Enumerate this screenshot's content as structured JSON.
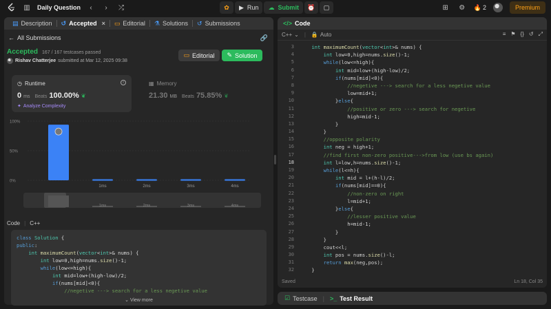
{
  "topbar": {
    "problem_list": "Daily Question",
    "run_label": "Run",
    "submit_label": "Submit",
    "streak_count": "2",
    "premium_label": "Premium"
  },
  "left_tabs": [
    {
      "label": "Description"
    },
    {
      "label": "Accepted"
    },
    {
      "label": "Editorial"
    },
    {
      "label": "Solutions"
    },
    {
      "label": "Submissions"
    }
  ],
  "submission": {
    "back_label": "All Submissions",
    "status": "Accepted",
    "passed": "167 / 167 testcases passed",
    "author": "Rishav Chatterjee",
    "submitted": "submitted at Mar 12, 2025 09:38",
    "editorial_btn": "Editorial",
    "solution_btn": "Solution"
  },
  "runtime": {
    "title": "Runtime",
    "value": "0",
    "unit": "ms",
    "beats_label": "Beats",
    "beats": "100.00%",
    "analyze": "Analyze Complexity"
  },
  "memory": {
    "title": "Memory",
    "value": "21.30",
    "unit": "MB",
    "beats_label": "Beats",
    "beats": "75.85%"
  },
  "chart_data": {
    "type": "bar",
    "categories": [
      "0ms",
      "1ms",
      "2ms",
      "3ms",
      "4ms"
    ],
    "category_labels": [
      "",
      "1ms",
      "2ms",
      "3ms",
      "4ms"
    ],
    "values": [
      94,
      2,
      2,
      2,
      2
    ],
    "ylim": [
      0,
      100
    ],
    "yticks": [
      "0%",
      "50%",
      "100%"
    ],
    "grid": true,
    "highlight_color": "#3b82f6"
  },
  "code_section": {
    "label": "Code",
    "lang": "C++",
    "view_more": "View more",
    "preview": [
      "class Solution {",
      "public:",
      "    int maximumCount(vector<int>& nums) {",
      "        int low=0,high=nums.size()-1;",
      "        while(low<=high){",
      "            int mid=low+(high-low)/2;",
      "            if(nums[mid]<0){",
      "                //negetive ---> search for a less negetive value"
    ]
  },
  "editor": {
    "title": "Code",
    "language": "C++",
    "mode": "Auto",
    "status": "Saved",
    "cursor": "Ln 18, Col 35",
    "first_line": 3,
    "current_line": 18,
    "lines": [
      "    int maximumCount(vector<int>& nums) {",
      "        int low=0,high=nums.size()-1;",
      "        while(low<=high){",
      "            int mid=low+(high-low)/2;",
      "            if(nums[mid]<0){",
      "                //negetive ---> search for a less negetive value",
      "                low=mid+1;",
      "            }else{",
      "                //positive or zero ---> search for negetive",
      "                high=mid-1;",
      "            }",
      "        }",
      "        //opposite polarity",
      "        int neg = high+1;",
      "        //find first non-zero positive--->from low (use bs again)",
      "        int l=low,h=nums.size()-1;",
      "        while(l<=h){",
      "            int mid = l+(h-l)/2;",
      "            if(nums[mid]==0){",
      "                //non-zero on right",
      "                l=mid+1;",
      "            }else{",
      "                //lesser positive value",
      "                h=mid-1;",
      "            }",
      "        }",
      "        cout<<l;",
      "        int pos = nums.size()-l;",
      "        return max(neg,pos);",
      "    }"
    ]
  },
  "bottom": {
    "testcase": "Testcase",
    "result": "Test Result"
  }
}
